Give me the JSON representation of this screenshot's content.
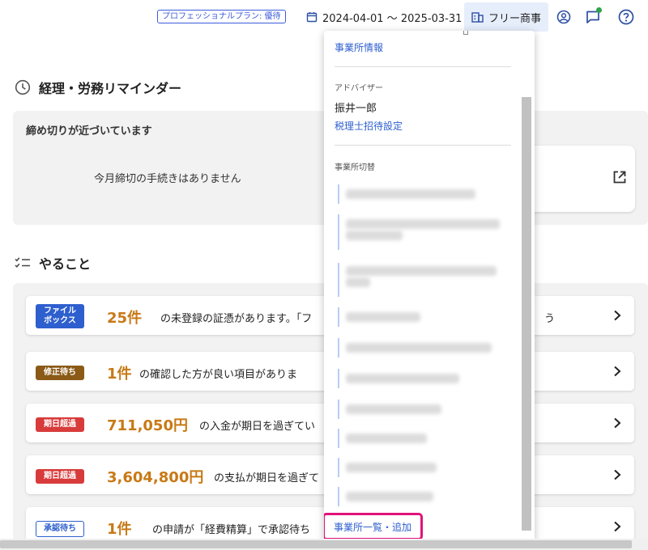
{
  "header": {
    "plan_badge": "プロフェッショナルプラン: 優待",
    "date_range": "2024-04-01 〜 2025-03-31",
    "office_button": "フリー商事",
    "icons": [
      "calendar-icon",
      "office-icon",
      "account-icon",
      "chat-icon",
      "help-icon"
    ]
  },
  "reminder": {
    "title": "経理・労務リマインダー",
    "subtitle": "締め切りが近づいています",
    "empty_message": "今月締切の手続きはありません"
  },
  "todo": {
    "title": "やること",
    "items": [
      {
        "tag": "ファイル\nボックス",
        "tag_style": "blue",
        "count": "25件",
        "text": "の未登録の証憑があります。「フ",
        "tail": "う"
      },
      {
        "tag": "修正待ち",
        "tag_style": "brown",
        "count": "1件",
        "text": "の確認した方が良い項目がありま"
      },
      {
        "tag": "期日超過",
        "tag_style": "red",
        "count": "711,050円",
        "text": "の入金が期日を過ぎてい"
      },
      {
        "tag": "期日超過",
        "tag_style": "red",
        "count": "3,604,800円",
        "text": "の支払が期日を過ぎて"
      },
      {
        "tag": "承認待ち",
        "tag_style": "outline",
        "count": "1件",
        "text": "の申請が「経費精算」で承認待ち"
      }
    ]
  },
  "dropdown": {
    "office_info": "事業所情報",
    "advisor_label": "アドバイザー",
    "advisor_name": "振井一郎",
    "invite_link": "税理士招待設定",
    "switch_label": "事業所切替",
    "offices_count_blurred": 10,
    "list_add_link": "事業所一覧・追加"
  },
  "colors": {
    "accent": "#2d5fce",
    "count_orange": "#c87916",
    "highlight_border": "#e3127a",
    "status_dot": "#2fa34a"
  }
}
